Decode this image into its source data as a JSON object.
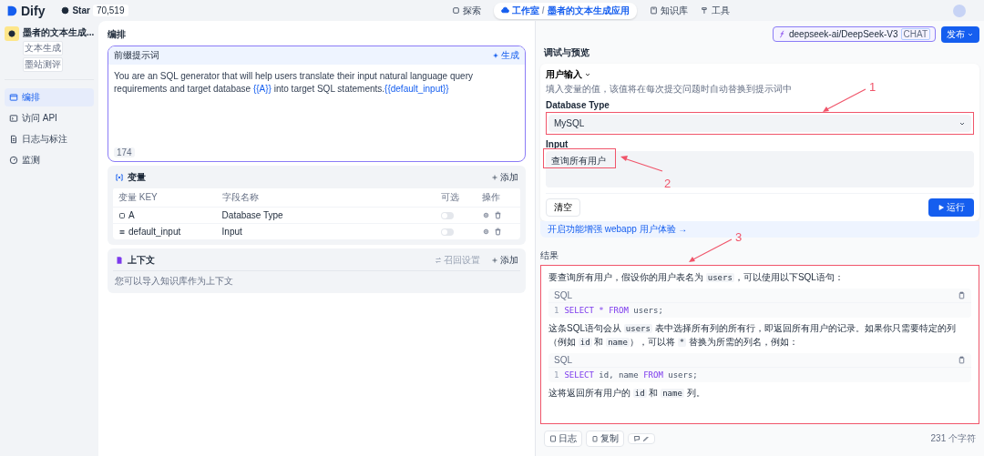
{
  "top_bar": {
    "logo": "Dify",
    "github": {
      "label": "Star",
      "count": "70,519"
    },
    "nav": [
      {
        "label": "探索",
        "selected": false,
        "kind": "link"
      },
      {
        "label": "工作室",
        "selected": true,
        "kind": "studio",
        "separator": "/",
        "app": "墨者的文本生成应用"
      },
      {
        "label": "知识库",
        "selected": false,
        "kind": "link"
      },
      {
        "label": "工具",
        "selected": false,
        "kind": "link"
      }
    ]
  },
  "sidebar": {
    "app_name": "墨者的文本生成...",
    "tags": [
      "文本生成",
      "墨站测评"
    ],
    "items": [
      {
        "label": "编排",
        "selected": true
      },
      {
        "label": "访问 API",
        "selected": false
      },
      {
        "label": "日志与标注",
        "selected": false
      },
      {
        "label": "监测",
        "selected": false
      }
    ]
  },
  "editor": {
    "title": "编排",
    "prompt": {
      "title": "前缀提示词",
      "generate": "生成",
      "count": "174",
      "segments": [
        {
          "kind": "text",
          "text": "You are an SQL generator that will help users translate their input natural language query requirements and target database "
        },
        {
          "kind": "var",
          "text": "{{A}}"
        },
        {
          "kind": "text",
          "text": " into target SQL statements."
        },
        {
          "kind": "var",
          "text": "{{default_input}}"
        }
      ]
    },
    "variables": {
      "title": "变量",
      "add": "添加",
      "columns": [
        "变量 KEY",
        "字段名称",
        "可选",
        "操作"
      ],
      "rows": [
        {
          "key": "A",
          "name": "Database Type",
          "optional": false,
          "kind": "select"
        },
        {
          "key": "default_input",
          "name": "Input",
          "optional": false,
          "kind": "paragraph"
        }
      ]
    },
    "context": {
      "title": "上下文",
      "settings": "召回设置",
      "add": "添加",
      "hint": "您可以导入知识库作为上下文"
    }
  },
  "debug": {
    "model": {
      "name": "deepseek-ai/DeepSeek-V3",
      "badge": "CHAT"
    },
    "publish": "发布",
    "title": "调试与预览",
    "user_input": {
      "title": "用户输入",
      "hint": "填入变量的值，该值将在每次提交问题时自动替换到提示词中",
      "fields": [
        {
          "label": "Database Type",
          "kind": "select",
          "value": "MySQL"
        },
        {
          "label": "Input",
          "kind": "textarea",
          "value": "查询所有用户"
        }
      ],
      "clear": "清空",
      "run": "运行"
    },
    "enhance": "开启功能增强 webapp 用户体验 →",
    "result_label": "结果",
    "result": [
      {
        "kind": "para",
        "segments": [
          {
            "kind": "text",
            "text": "要查询所有用户，假设你的用户表名为 "
          },
          {
            "kind": "code",
            "text": "users"
          },
          {
            "kind": "text",
            "text": "，可以使用以下SQL语句："
          }
        ]
      },
      {
        "kind": "codeblock",
        "lang": "SQL",
        "line": "1",
        "tokens": [
          {
            "kind": "kw",
            "text": "SELECT * FROM"
          },
          {
            "kind": "plain",
            "text": " users;"
          }
        ]
      },
      {
        "kind": "para",
        "segments": [
          {
            "kind": "text",
            "text": "这条SQL语句会从 "
          },
          {
            "kind": "code",
            "text": "users"
          },
          {
            "kind": "text",
            "text": " 表中选择所有列的所有行，即返回所有用户的记录。如果你只需要特定的列（例如 "
          },
          {
            "kind": "code",
            "text": "id"
          },
          {
            "kind": "text",
            "text": " 和 "
          },
          {
            "kind": "code",
            "text": "name"
          },
          {
            "kind": "text",
            "text": "），可以将 "
          },
          {
            "kind": "code",
            "text": "*"
          },
          {
            "kind": "text",
            "text": " 替换为所需的列名，例如："
          }
        ]
      },
      {
        "kind": "codeblock",
        "lang": "SQL",
        "line": "1",
        "tokens": [
          {
            "kind": "kw",
            "text": "SELECT"
          },
          {
            "kind": "plain",
            "text": " id, name "
          },
          {
            "kind": "kw",
            "text": "FROM"
          },
          {
            "kind": "plain",
            "text": " users;"
          }
        ]
      },
      {
        "kind": "para",
        "segments": [
          {
            "kind": "text",
            "text": "这将返回所有用户的 "
          },
          {
            "kind": "code",
            "text": "id"
          },
          {
            "kind": "text",
            "text": " 和 "
          },
          {
            "kind": "code",
            "text": "name"
          },
          {
            "kind": "text",
            "text": " 列。"
          }
        ]
      }
    ],
    "footer": {
      "log": "日志",
      "copy": "复制",
      "chars": "231 个字符"
    }
  },
  "annotations": [
    {
      "label": "1"
    },
    {
      "label": "2"
    },
    {
      "label": "3"
    }
  ]
}
